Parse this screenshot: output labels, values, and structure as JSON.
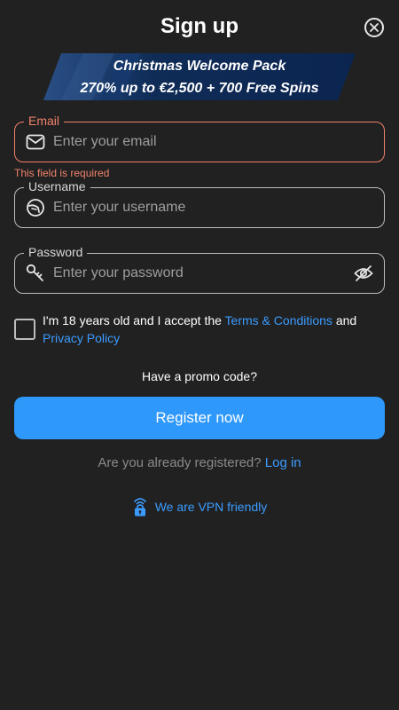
{
  "header": {
    "title": "Sign up"
  },
  "promo": {
    "line1": "Christmas Welcome Pack",
    "line2": "270% up to €2,500 + 700 Free Spins"
  },
  "form": {
    "email": {
      "label": "Email",
      "placeholder": "Enter your email",
      "value": "",
      "error": "This field is required",
      "icon": "envelope-icon"
    },
    "username": {
      "label": "Username",
      "placeholder": "Enter your username",
      "value": "",
      "icon": "helmet-icon"
    },
    "password": {
      "label": "Password",
      "placeholder": "Enter your password",
      "value": "",
      "icon": "key-icon",
      "toggle_icon": "eye-off-icon"
    }
  },
  "terms": {
    "checked": false,
    "text_before": "I'm 18 years old and I accept the ",
    "terms_link": "Terms & Conditions",
    "text_and": " and",
    "privacy_link": "Privacy Policy"
  },
  "promo_code_label": "Have a promo code?",
  "register_label": "Register now",
  "login": {
    "question": "Are you already registered?",
    "link": "Log in"
  },
  "vpn": {
    "label": "We are VPN friendly",
    "icon": "wifi-lock-icon"
  },
  "colors": {
    "background": "#212121",
    "accent": "#2e98fb",
    "link": "#3b9cff",
    "error": "#f0826b",
    "banner": "#0d2a55"
  }
}
